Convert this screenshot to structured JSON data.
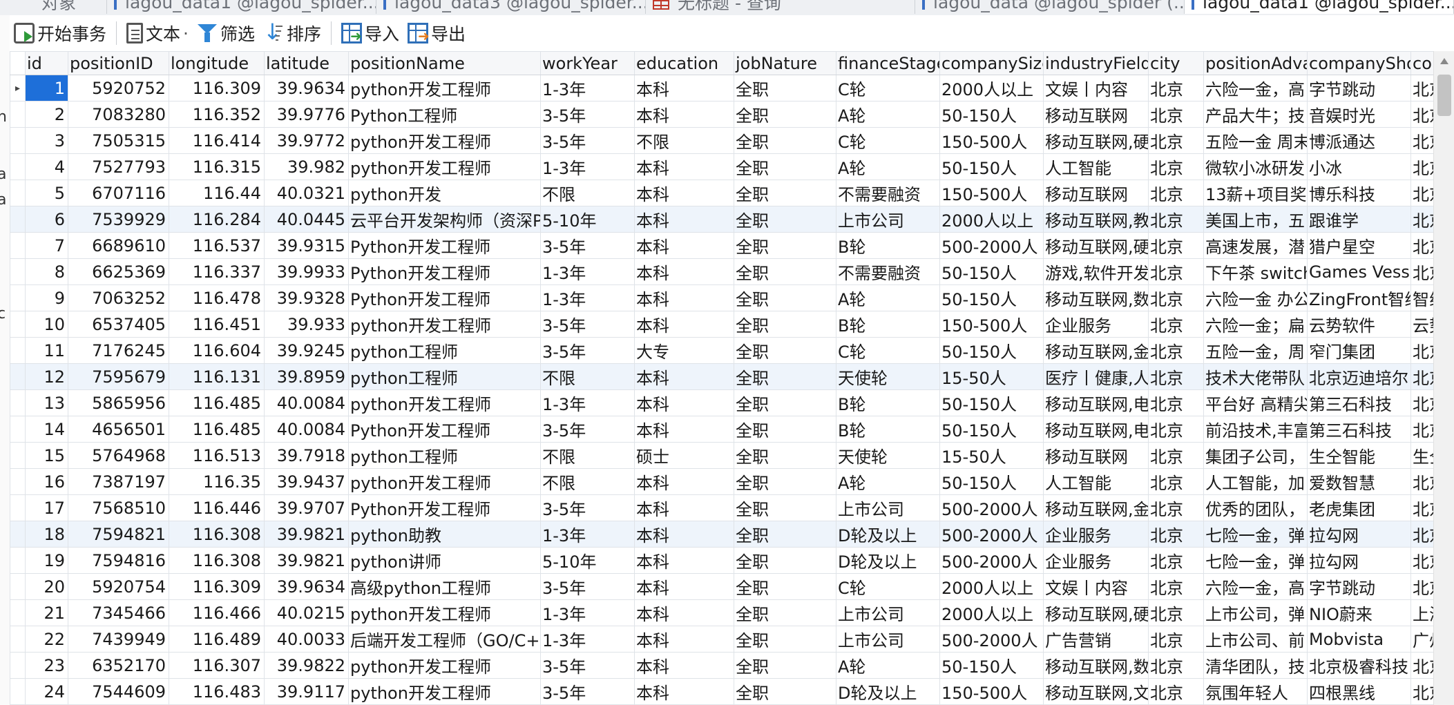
{
  "tabs": [
    {
      "label": "对象",
      "icon": "none"
    },
    {
      "label": "lagou_data1 @lagou_spider...",
      "icon": "table-icon"
    },
    {
      "label": "lagou_data3 @lagou_spider...",
      "icon": "table-icon"
    },
    {
      "label": "无标题 - 查询",
      "icon": "query-icon"
    },
    {
      "label": "lagou_data @lagou_spider (...",
      "icon": "table-icon"
    },
    {
      "label": "lagou_data1 @lagou_spider...",
      "icon": "table-icon"
    }
  ],
  "sidebar_fragments": [
    "h",
    "a",
    "a",
    "c"
  ],
  "toolbar": {
    "begin_transaction": "开始事务",
    "text": "文本",
    "text_dropdown": "·",
    "filter": "筛选",
    "sort": "排序",
    "import": "导入",
    "export": "导出"
  },
  "columns": [
    "id",
    "positionID",
    "longitude",
    "latitude",
    "positionName",
    "workYear",
    "education",
    "jobNature",
    "financeStage",
    "companySize",
    "industryField",
    "city",
    "positionAdvantage",
    "companyShortName",
    "co"
  ],
  "rows": [
    [
      "1",
      "5920752",
      "116.309",
      "39.9634",
      "python开发工程师",
      "1-3年",
      "本科",
      "全职",
      "C轮",
      "2000人以上",
      "文娱丨内容",
      "北京",
      "六险一金，高",
      "字节跳动",
      "北京"
    ],
    [
      "2",
      "7083280",
      "116.352",
      "39.9776",
      "Python工程师",
      "3-5年",
      "本科",
      "全职",
      "A轮",
      "50-150人",
      "移动互联网",
      "北京",
      "产品大牛；技",
      "音娱时光",
      "北京"
    ],
    [
      "3",
      "7505315",
      "116.414",
      "39.9772",
      "python开发工程师",
      "3-5年",
      "不限",
      "全职",
      "C轮",
      "150-500人",
      "移动互联网,硬",
      "北京",
      "五险一金 周末",
      "博派通达",
      "北京"
    ],
    [
      "4",
      "7527793",
      "116.315",
      "39.982",
      "python开发工程师",
      "1-3年",
      "本科",
      "全职",
      "A轮",
      "50-150人",
      "人工智能",
      "北京",
      "微软小冰研发",
      "小冰",
      "北京"
    ],
    [
      "5",
      "6707116",
      "116.44",
      "40.0321",
      "python开发",
      "不限",
      "本科",
      "全职",
      "不需要融资",
      "150-500人",
      "移动互联网",
      "北京",
      "13薪+项目奖",
      "博乐科技",
      "北京"
    ],
    [
      "6",
      "7539929",
      "116.284",
      "40.0445",
      "云平台开发架构师（资深P",
      "5-10年",
      "本科",
      "全职",
      "上市公司",
      "2000人以上",
      "移动互联网,教",
      "北京",
      "美国上市，五",
      "跟谁学",
      "北京"
    ],
    [
      "7",
      "6689610",
      "116.537",
      "39.9315",
      "Python开发工程师",
      "3-5年",
      "本科",
      "全职",
      "B轮",
      "500-2000人",
      "移动互联网,硬",
      "北京",
      "高速发展，潜",
      "猎户星空",
      "北京"
    ],
    [
      "8",
      "6625369",
      "116.337",
      "39.9933",
      "Python开发工程师",
      "1-3年",
      "本科",
      "全职",
      "不需要融资",
      "50-150人",
      "游戏,软件开发",
      "北京",
      "下午茶 switch",
      "Games Vessel",
      "北京"
    ],
    [
      "9",
      "7063252",
      "116.478",
      "39.9328",
      "Python开发工程师",
      "1-3年",
      "本科",
      "全职",
      "A轮",
      "50-150人",
      "移动互联网,数",
      "北京",
      "六险一金 办公",
      "ZingFront智线",
      "智线"
    ],
    [
      "10",
      "6537405",
      "116.451",
      "39.933",
      "python开发工程师",
      "3-5年",
      "本科",
      "全职",
      "B轮",
      "150-500人",
      "企业服务",
      "北京",
      "六险一金；扁",
      "云势软件",
      "云势"
    ],
    [
      "11",
      "7176245",
      "116.604",
      "39.9245",
      "python工程师",
      "3-5年",
      "大专",
      "全职",
      "C轮",
      "50-150人",
      "移动互联网,金",
      "北京",
      "五险一金，周",
      "窄门集团",
      "北京"
    ],
    [
      "12",
      "7595679",
      "116.131",
      "39.8959",
      "python工程师",
      "不限",
      "本科",
      "全职",
      "天使轮",
      "15-50人",
      "医疗丨健康,人",
      "北京",
      "技术大佬带队",
      "北京迈迪培尔",
      "北京"
    ],
    [
      "13",
      "5865956",
      "116.485",
      "40.0084",
      "python开发工程师",
      "1-3年",
      "本科",
      "全职",
      "B轮",
      "50-150人",
      "移动互联网,电",
      "北京",
      "平台好 高精尖",
      "第三石科技",
      "北京"
    ],
    [
      "14",
      "4656501",
      "116.485",
      "40.0084",
      "Python开发工程师",
      "3-5年",
      "本科",
      "全职",
      "B轮",
      "50-150人",
      "移动互联网,电",
      "北京",
      "前沿技术,丰富",
      "第三石科技",
      "北京"
    ],
    [
      "15",
      "5764968",
      "116.513",
      "39.7918",
      "python工程师",
      "不限",
      "硕士",
      "全职",
      "天使轮",
      "15-50人",
      "移动互联网",
      "北京",
      "集团子公司，",
      "生仝智能",
      "生仝"
    ],
    [
      "16",
      "7387197",
      "116.35",
      "39.9437",
      "python开发工程师",
      "不限",
      "本科",
      "全职",
      "A轮",
      "50-150人",
      "人工智能",
      "北京",
      "人工智能，加",
      "爱数智慧",
      "北京"
    ],
    [
      "17",
      "7568510",
      "116.446",
      "39.9707",
      "Python开发工程师",
      "3-5年",
      "本科",
      "全职",
      "上市公司",
      "500-2000人",
      "移动互联网,金",
      "北京",
      "优秀的团队，",
      "老虎集团",
      "北京"
    ],
    [
      "18",
      "7594821",
      "116.308",
      "39.9821",
      "python助教",
      "1-3年",
      "本科",
      "全职",
      "D轮及以上",
      "500-2000人",
      "企业服务",
      "北京",
      "七险一金，弹",
      "拉勾网",
      "北京"
    ],
    [
      "19",
      "7594816",
      "116.308",
      "39.9821",
      "python讲师",
      "5-10年",
      "本科",
      "全职",
      "D轮及以上",
      "500-2000人",
      "企业服务",
      "北京",
      "七险一金，弹",
      "拉勾网",
      "北京"
    ],
    [
      "20",
      "5920754",
      "116.309",
      "39.9634",
      "高级python工程师",
      "3-5年",
      "本科",
      "全职",
      "C轮",
      "2000人以上",
      "文娱丨内容",
      "北京",
      "六险一金，高",
      "字节跳动",
      "北京"
    ],
    [
      "21",
      "7345466",
      "116.466",
      "40.0215",
      "python开发工程师",
      "1-3年",
      "本科",
      "全职",
      "上市公司",
      "2000人以上",
      "移动互联网,硬",
      "北京",
      "上市公司，弹",
      "NIO蔚来",
      "上海"
    ],
    [
      "22",
      "7439949",
      "116.489",
      "40.0033",
      "后端开发工程师（GO/C+",
      "1-3年",
      "本科",
      "全职",
      "上市公司",
      "500-2000人",
      "广告营销",
      "北京",
      "上市公司、前",
      "Mobvista",
      "广州"
    ],
    [
      "23",
      "6352170",
      "116.307",
      "39.9822",
      "python开发工程师",
      "3-5年",
      "本科",
      "全职",
      "A轮",
      "50-150人",
      "移动互联网,数",
      "北京",
      "清华团队，技",
      "北京极睿科技",
      "北京"
    ],
    [
      "24",
      "7544609",
      "116.483",
      "39.9117",
      "python开发工程师",
      "3-5年",
      "本科",
      "全职",
      "D轮及以上",
      "150-500人",
      "移动互联网,文",
      "北京",
      "氛围年轻人",
      "四根黑线",
      "北京"
    ]
  ],
  "selected_cell": {
    "row": 0,
    "col": 0
  },
  "colors": {
    "selection": "#1e6fd9",
    "highlight_row": "#eef4fb",
    "grid_line": "#dfe3e8"
  }
}
